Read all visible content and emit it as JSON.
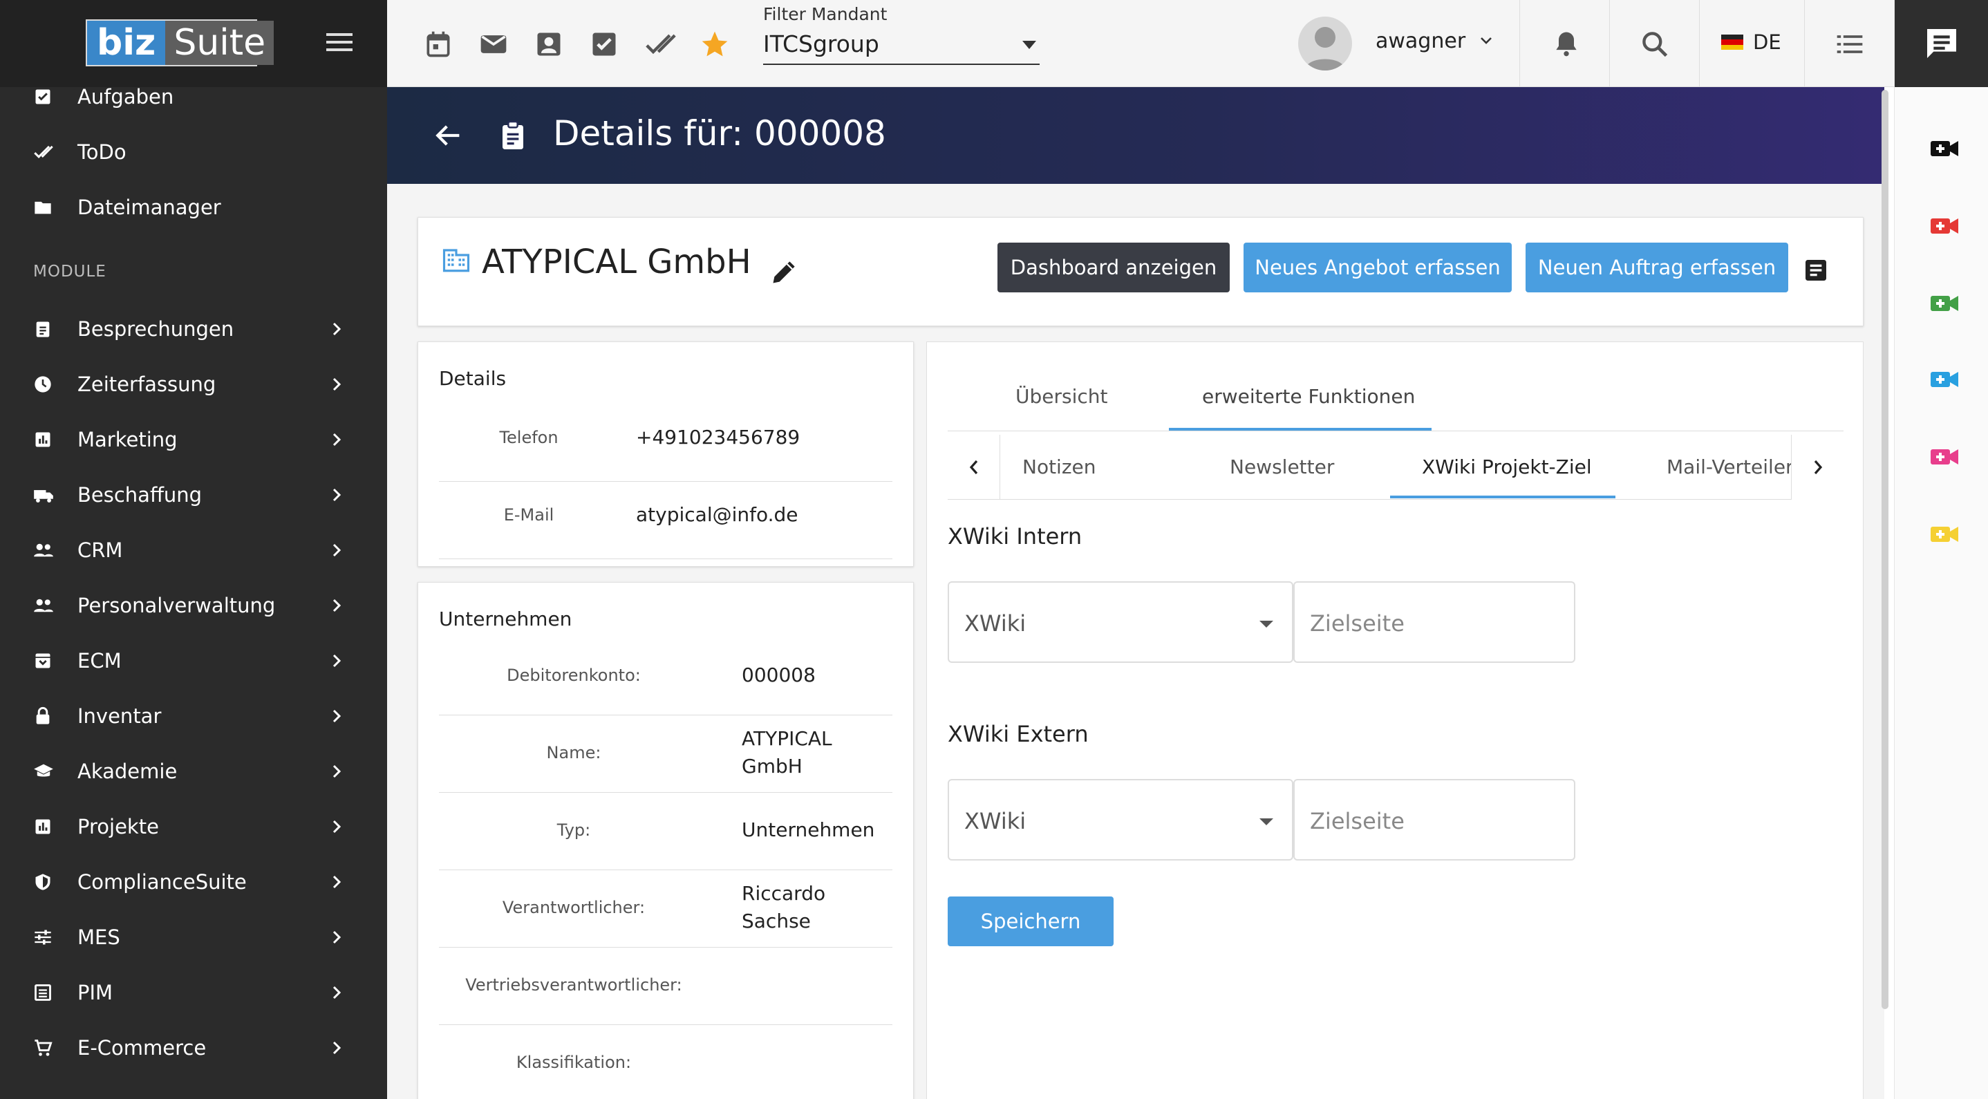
{
  "brand": {
    "part1": "biz",
    "part2": "Suite"
  },
  "sidebar": {
    "top_items": [
      {
        "label": "Aufgaben",
        "icon": "checkbox-icon"
      },
      {
        "label": "ToDo",
        "icon": "done-all-icon"
      },
      {
        "label": "Dateimanager",
        "icon": "folder-icon"
      }
    ],
    "section_label": "MODULE",
    "modules": [
      {
        "label": "Besprechungen",
        "icon": "assignment-icon"
      },
      {
        "label": "Zeiterfassung",
        "icon": "clock-icon"
      },
      {
        "label": "Marketing",
        "icon": "bar-chart-icon"
      },
      {
        "label": "Beschaffung",
        "icon": "truck-icon"
      },
      {
        "label": "CRM",
        "icon": "people-icon"
      },
      {
        "label": "Personalverwaltung",
        "icon": "people-icon"
      },
      {
        "label": "ECM",
        "icon": "archive-icon"
      },
      {
        "label": "Inventar",
        "icon": "lock-icon"
      },
      {
        "label": "Akademie",
        "icon": "school-icon"
      },
      {
        "label": "Projekte",
        "icon": "bar-chart-icon"
      },
      {
        "label": "ComplianceSuite",
        "icon": "shield-icon"
      },
      {
        "label": "MES",
        "icon": "tune-icon"
      },
      {
        "label": "PIM",
        "icon": "list-alt-icon"
      },
      {
        "label": "E-Commerce",
        "icon": "cart-icon"
      }
    ]
  },
  "topbar": {
    "filter_label": "Filter Mandant",
    "filter_value": "ITCSgroup",
    "username": "awagner",
    "language": "DE"
  },
  "header": {
    "title": "Details für: 000008"
  },
  "company": {
    "name": "ATYPICAL GmbH",
    "buttons": {
      "dashboard": "Dashboard anzeigen",
      "angebot": "Neues Angebot erfassen",
      "auftrag": "Neuen Auftrag erfassen"
    }
  },
  "details": {
    "title": "Details",
    "rows": [
      {
        "label": "Telefon",
        "value": "+491023456789"
      },
      {
        "label": "E-Mail",
        "value": "atypical@info.de"
      }
    ]
  },
  "unternehmen": {
    "title": "Unternehmen",
    "rows": [
      {
        "label": "Debitorenkonto:",
        "value": "000008"
      },
      {
        "label": "Name:",
        "value": "ATYPICAL GmbH"
      },
      {
        "label": "Typ:",
        "value": "Unternehmen"
      },
      {
        "label": "Verantwortlicher:",
        "value": "Riccardo Sachse"
      },
      {
        "label": "Vertriebsverantwortlicher:",
        "value": ""
      },
      {
        "label": "Klassifikation:",
        "value": ""
      }
    ]
  },
  "tabs": {
    "main": [
      "Übersicht",
      "erweiterte Funktionen"
    ],
    "active_main": 1
  },
  "subtabs": {
    "items": [
      "Notizen",
      "Newsletter",
      "XWiki Projekt-Ziel",
      "Mail-Verteiler"
    ],
    "active": 2
  },
  "xwiki": {
    "intern_title": "XWiki Intern",
    "extern_title": "XWiki Extern",
    "select_value": "XWiki",
    "target_placeholder": "Zielseite",
    "save_label": "Speichern"
  },
  "colors": {
    "accent": "#4a9ee0",
    "dark_button": "#3a3d45",
    "sidebar": "#2b2b2b",
    "favorite_star": "#f5a623"
  }
}
